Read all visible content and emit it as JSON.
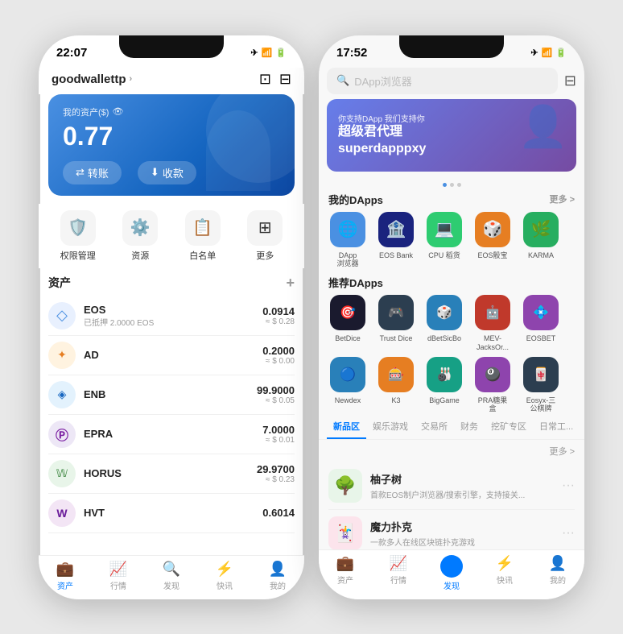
{
  "left_phone": {
    "status_time": "22:07",
    "wallet_name": "goodwallettp",
    "asset_label": "我的资产($)",
    "asset_amount": "0.77",
    "transfer_btn": "转账",
    "receive_btn": "收款",
    "quick_actions": [
      {
        "icon": "🛡️",
        "label": "权限管理"
      },
      {
        "icon": "⚙️",
        "label": "资源"
      },
      {
        "icon": "📋",
        "label": "白名单"
      },
      {
        "icon": "⊞",
        "label": "更多"
      }
    ],
    "assets_title": "资产",
    "assets": [
      {
        "logo": "◇",
        "name": "EOS",
        "sub": "已抵押 2.0000 EOS",
        "amount": "0.0914",
        "usd": "≈ $ 0.28"
      },
      {
        "logo": "✦",
        "name": "AD",
        "sub": "",
        "amount": "0.2000",
        "usd": "≈ $ 0.00"
      },
      {
        "logo": "◈",
        "name": "ENB",
        "sub": "",
        "amount": "99.9000",
        "usd": "≈ $ 0.05"
      },
      {
        "logo": "Ⓟ",
        "name": "EPRA",
        "sub": "",
        "amount": "7.0000",
        "usd": "≈ $ 0.01"
      },
      {
        "logo": "𝕎",
        "name": "HORUS",
        "sub": "",
        "amount": "29.9700",
        "usd": "≈ $ 0.23"
      },
      {
        "logo": "W",
        "name": "HVT",
        "sub": "",
        "amount": "0.6014",
        "usd": ""
      }
    ],
    "nav": [
      {
        "icon": "💼",
        "label": "资产",
        "active": true
      },
      {
        "icon": "📈",
        "label": "行情",
        "active": false
      },
      {
        "icon": "🔍",
        "label": "发现",
        "active": false
      },
      {
        "icon": "⚡",
        "label": "快讯",
        "active": false
      },
      {
        "icon": "👤",
        "label": "我的",
        "active": false
      }
    ]
  },
  "right_phone": {
    "status_time": "17:52",
    "search_placeholder": "DApp浏览器",
    "banner": {
      "sub": "你支持DApp 我们支持你",
      "title": "超级君代理\nsuperdapppxy"
    },
    "my_dapps_title": "我的DApps",
    "more_label": "更多 >",
    "my_dapps": [
      {
        "icon": "🌐",
        "bg": "#4A90E2",
        "label": "DApp\n浏览器"
      },
      {
        "icon": "🏦",
        "bg": "#1a1a2e",
        "label": "EOS Bank"
      },
      {
        "icon": "💻",
        "bg": "#2ecc71",
        "label": "CPU 稻货"
      },
      {
        "icon": "🎲",
        "bg": "#e67e22",
        "label": "EOS骰宝"
      },
      {
        "icon": "🌿",
        "bg": "#27ae60",
        "label": "KARMA"
      }
    ],
    "recommended_title": "推荐DApps",
    "recommended": [
      {
        "icon": "🎯",
        "bg": "#1a1a1a",
        "label": "BetDice"
      },
      {
        "icon": "🎮",
        "bg": "#2c3e50",
        "label": "Trust Dice"
      },
      {
        "icon": "🎲",
        "bg": "#3498db",
        "label": "dBetSicBo"
      },
      {
        "icon": "🤖",
        "bg": "#e74c3c",
        "label": "MEV-\nJacksOr..."
      },
      {
        "icon": "💠",
        "bg": "#9b59b6",
        "label": "EOSBET"
      },
      {
        "icon": "🔵",
        "bg": "#3498db",
        "label": "Newdex"
      },
      {
        "icon": "🎰",
        "bg": "#e67e22",
        "label": "K3"
      },
      {
        "icon": "🎳",
        "bg": "#1abc9c",
        "label": "BigGame"
      },
      {
        "icon": "🎱",
        "bg": "#9b59b6",
        "label": "PRA糖果\n盒"
      },
      {
        "icon": "🀄",
        "bg": "#2c3e50",
        "label": "Eosyx-三\n公棋牌"
      }
    ],
    "tabs": [
      {
        "label": "新品区",
        "active": true
      },
      {
        "label": "娱乐游戏",
        "active": false
      },
      {
        "label": "交易所",
        "active": false
      },
      {
        "label": "财务",
        "active": false
      },
      {
        "label": "挖矿专区",
        "active": false
      },
      {
        "label": "日常工...",
        "active": false
      }
    ],
    "new_apps": [
      {
        "icon": "🌳",
        "bg": "#e8f5e9",
        "name": "柚子树",
        "desc": "首款EOS制户浏览器/搜索引擎，支持接关..."
      },
      {
        "icon": "🃏",
        "bg": "#fce4ec",
        "name": "魔力扑克",
        "desc": "一款多人在线区块链扑克游戏"
      }
    ],
    "nav": [
      {
        "icon": "💼",
        "label": "资产",
        "active": false
      },
      {
        "icon": "📈",
        "label": "行情",
        "active": false
      },
      {
        "icon": "🔍",
        "label": "发现",
        "active": true
      },
      {
        "icon": "⚡",
        "label": "快讯",
        "active": false
      },
      {
        "icon": "👤",
        "label": "我的",
        "active": false
      }
    ]
  }
}
